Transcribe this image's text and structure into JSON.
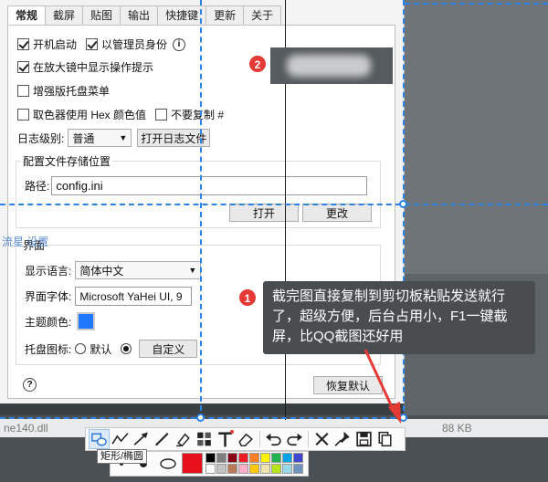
{
  "tabs": [
    {
      "label": "常规"
    },
    {
      "label": "截屏"
    },
    {
      "label": "贴图"
    },
    {
      "label": "输出"
    },
    {
      "label": "快捷键"
    },
    {
      "label": "更新"
    },
    {
      "label": "关于"
    }
  ],
  "general": {
    "autostart_label": "开机启动",
    "admin_label": "以管理员身份",
    "magnifier_label": "在放大镜中显示操作提示",
    "tray_menu_label": "增强版托盘菜单",
    "hex_label": "取色器使用 Hex 颜色值",
    "no_copy_label": "不要复制 #",
    "log_level_label": "日志级别:",
    "log_level_value": "普通",
    "open_log_button": "打开日志文件",
    "config_group_title": "配置文件存储位置",
    "path_label": "路径:",
    "path_value": "config.ini",
    "open_button": "打开",
    "change_button": "更改"
  },
  "ui": {
    "group_title": "界面",
    "language_label": "显示语言:",
    "language_value": "简体中文",
    "font_label": "界面字体:",
    "font_value": "Microsoft YaHei UI, 9",
    "theme_color_label": "主题颜色:",
    "theme_color": "#1e78ff",
    "tray_icon_label": "托盘图标:",
    "default_label": "默认",
    "custom_button": "自定义",
    "restore_button": "恢复默认"
  },
  "overlay": {
    "faint_label": "流星 设置",
    "badge_one": "1",
    "badge_two": "2",
    "callout_text": "截完图直接复制到剪切板粘贴发送就行了，超级方便，后台占用小，F1一键截屏，比QQ截图还好用",
    "bg_file_name": "ne140.dll",
    "bg_file_size": "88 KB"
  },
  "toolbar": {
    "tools": [
      "rectangle-ellipse",
      "curve",
      "arrow",
      "pen",
      "marker",
      "mosaic",
      "text",
      "eraser",
      "undo",
      "redo",
      "cancel",
      "pin",
      "save",
      "copy"
    ],
    "tooltip": "矩形/椭圆",
    "current_color": "#e8101b",
    "palette": [
      "#000000",
      "#7f7f7f",
      "#880015",
      "#ed1c24",
      "#ff7f27",
      "#fff200",
      "#22b14c",
      "#00a2e8",
      "#3f48cc",
      "#ffffff",
      "#c3c3c3",
      "#b97a57",
      "#ffaec9",
      "#ffc90e",
      "#efe4b0",
      "#b5e61d",
      "#99d9ea",
      "#7092be"
    ]
  },
  "colors": {
    "selection": "#2d82e6",
    "badge": "#e53935"
  }
}
